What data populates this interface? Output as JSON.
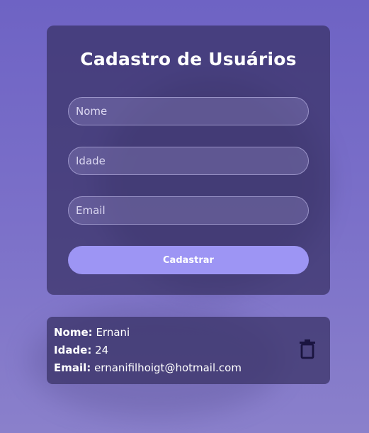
{
  "form": {
    "title": "Cadastro de Usuários",
    "fields": [
      {
        "placeholder": "Nome",
        "value": ""
      },
      {
        "placeholder": "Idade",
        "value": ""
      },
      {
        "placeholder": "Email",
        "value": ""
      }
    ],
    "submit_label": "Cadastrar"
  },
  "users": [
    {
      "name_label": "Nome:",
      "name": "Ernani",
      "age_label": "Idade:",
      "age": "24",
      "email_label": "Email:",
      "email": "ernanifilhoigt@hotmail.com",
      "delete_icon": "trash-icon"
    }
  ],
  "colors": {
    "accent_button": "#9d95f4",
    "trash_icon": "#1a1440"
  }
}
